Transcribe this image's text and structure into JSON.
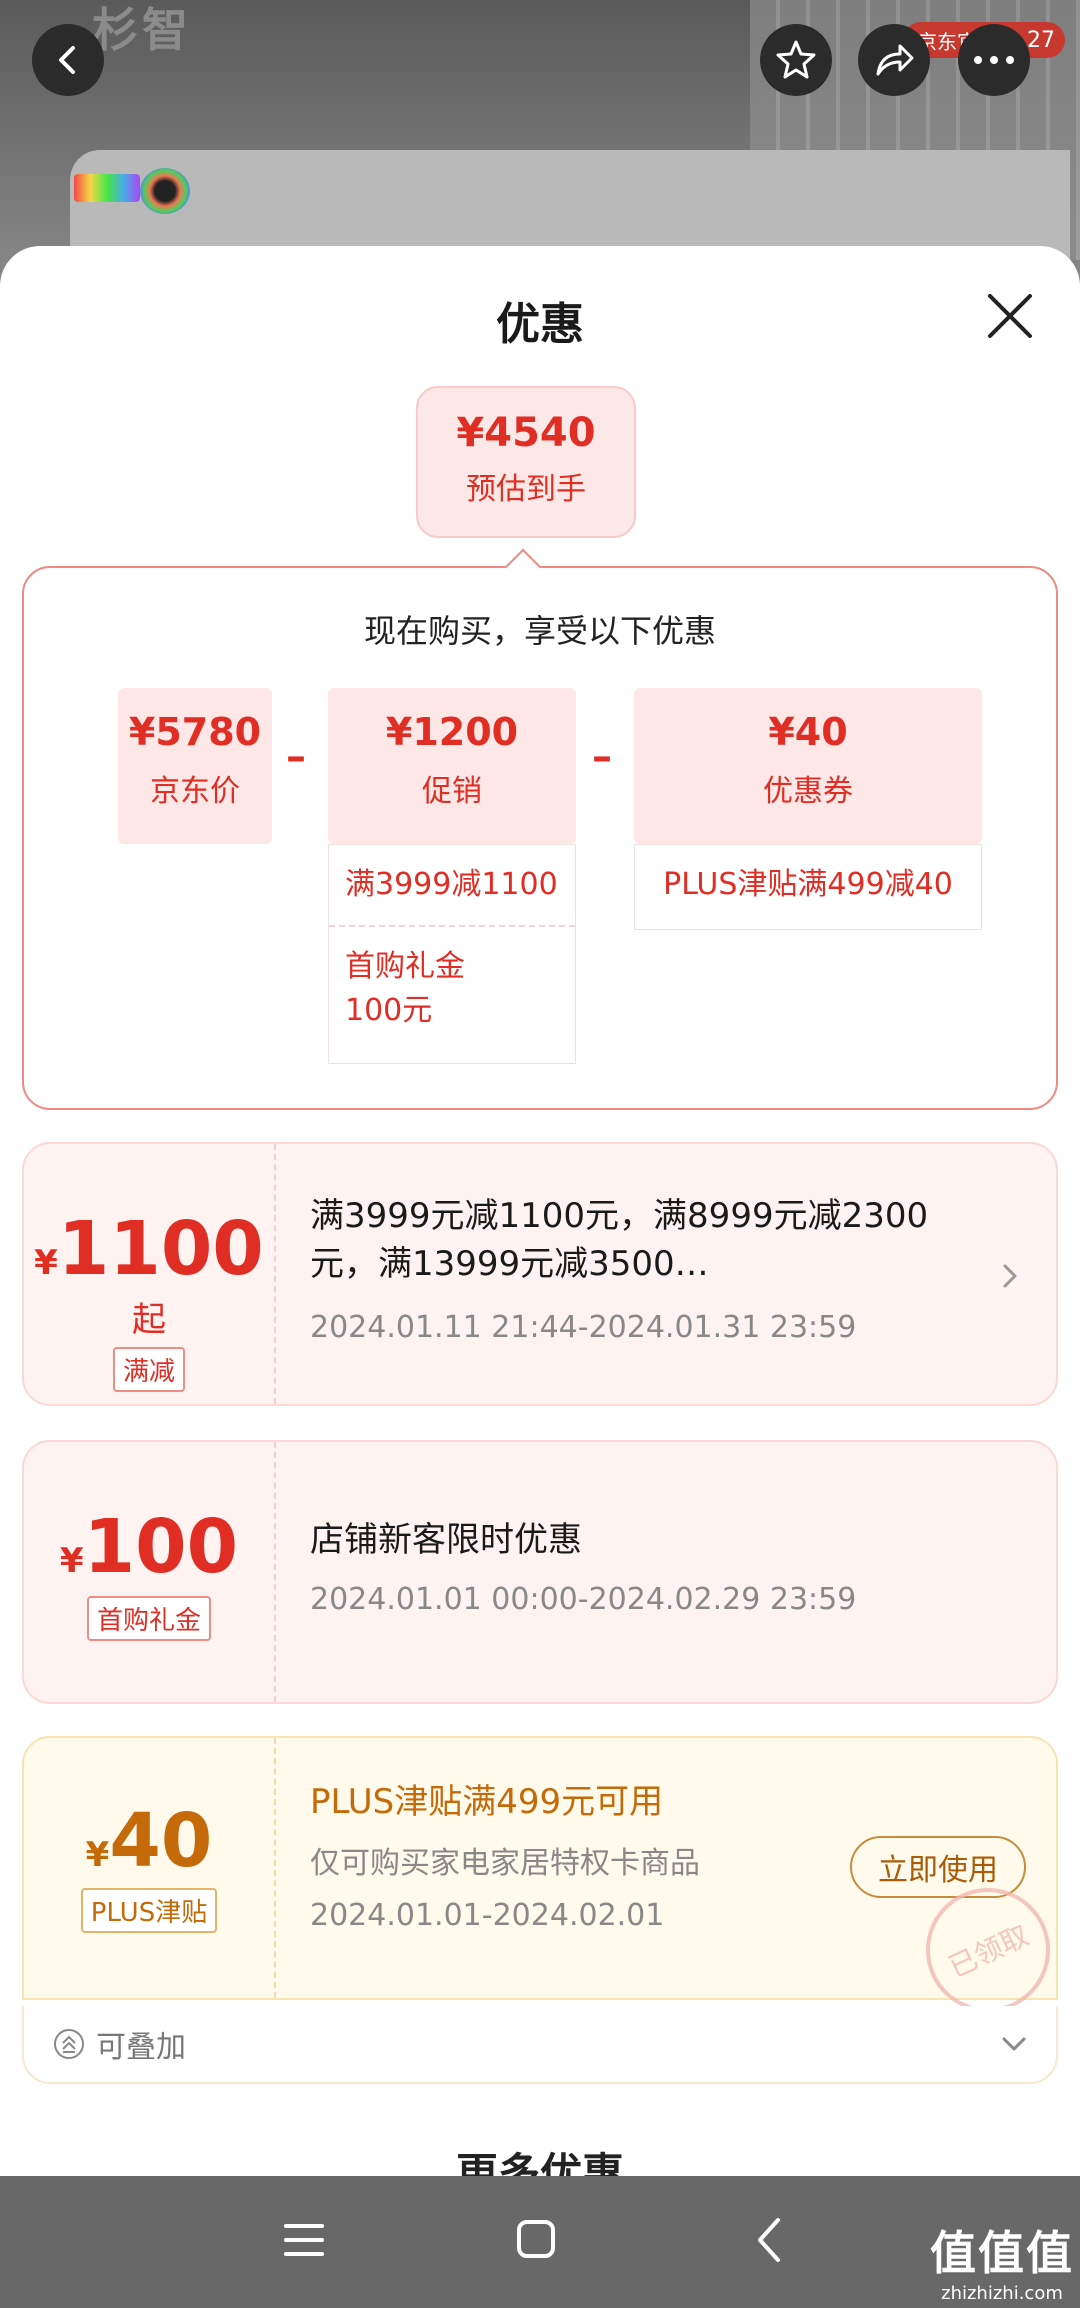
{
  "header": {
    "brand_text": "杉智",
    "official_badge": "京东官方认",
    "badge_count": "27"
  },
  "sheet": {
    "title": "优惠",
    "estimate": {
      "price": "¥4540",
      "label": "预估到手"
    },
    "breakdown": {
      "heading": "现在购买，享受以下优惠",
      "jd_price": {
        "value": "¥5780",
        "label": "京东价"
      },
      "promo": {
        "value": "¥1200",
        "label": "促销",
        "items": [
          "满3999减1100",
          "首购礼金\n100元"
        ]
      },
      "coupon": {
        "value": "¥40",
        "label": "优惠券",
        "items": [
          "PLUS津贴满499减40"
        ]
      },
      "minus_sign": "–"
    },
    "coupons": [
      {
        "yen": "¥",
        "amount": "1100",
        "suffix": "起",
        "tag": "满减",
        "title": "满3999元减1100元，满8999元减2300元，满13999元减3500…",
        "time": "2024.01.11 21:44-2024.01.31 23:59"
      },
      {
        "yen": "¥",
        "amount": "100",
        "suffix": "",
        "tag": "首购礼金",
        "title": "店铺新客限时优惠",
        "time": "2024.01.01 00:00-2024.02.29 23:59"
      },
      {
        "yen": "¥",
        "amount": "40",
        "suffix": "",
        "tag": "PLUS津贴",
        "title": "PLUS津贴满499元可用",
        "sub": "仅可购买家电家居特权卡商品",
        "time": "2024.01.01-2024.02.01",
        "button": "立即使用",
        "stamp": "已领取"
      }
    ],
    "stackable_label": "可叠加",
    "more_title": "更多优惠"
  },
  "watermark": {
    "line1": "值值值",
    "line2": "zhizhizhi.com"
  },
  "colors": {
    "accent": "#e02e24",
    "gold": "#c46a09"
  }
}
